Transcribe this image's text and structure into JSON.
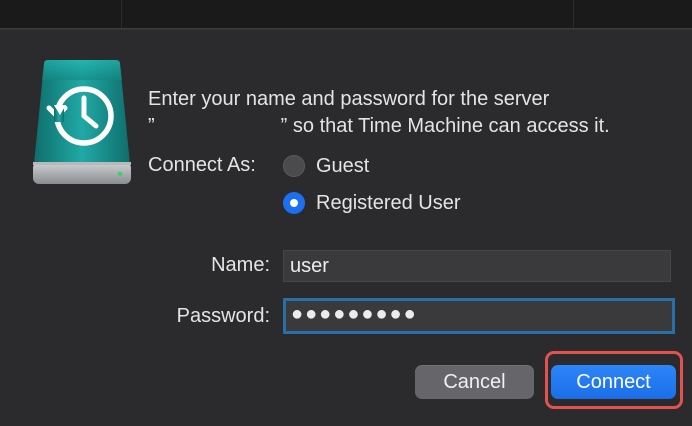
{
  "dialog": {
    "message_line1": "Enter your name and password for the server",
    "message_line2_open_quote": "”",
    "message_line2_rest": "” so that Time Machine can access it."
  },
  "connect_as": {
    "label": "Connect As:",
    "options": [
      {
        "label": "Guest",
        "selected": false
      },
      {
        "label": "Registered User",
        "selected": true
      }
    ]
  },
  "fields": {
    "name_label": "Name:",
    "name_value": "user",
    "password_label": "Password:",
    "password_value": "●●●●●●●●●"
  },
  "buttons": {
    "cancel": "Cancel",
    "connect": "Connect"
  },
  "colors": {
    "accent": "#1d6ff2",
    "highlight": "#e3524f",
    "icon_teal": "#1fa3a0"
  },
  "icon": "time-machine-disk-icon"
}
